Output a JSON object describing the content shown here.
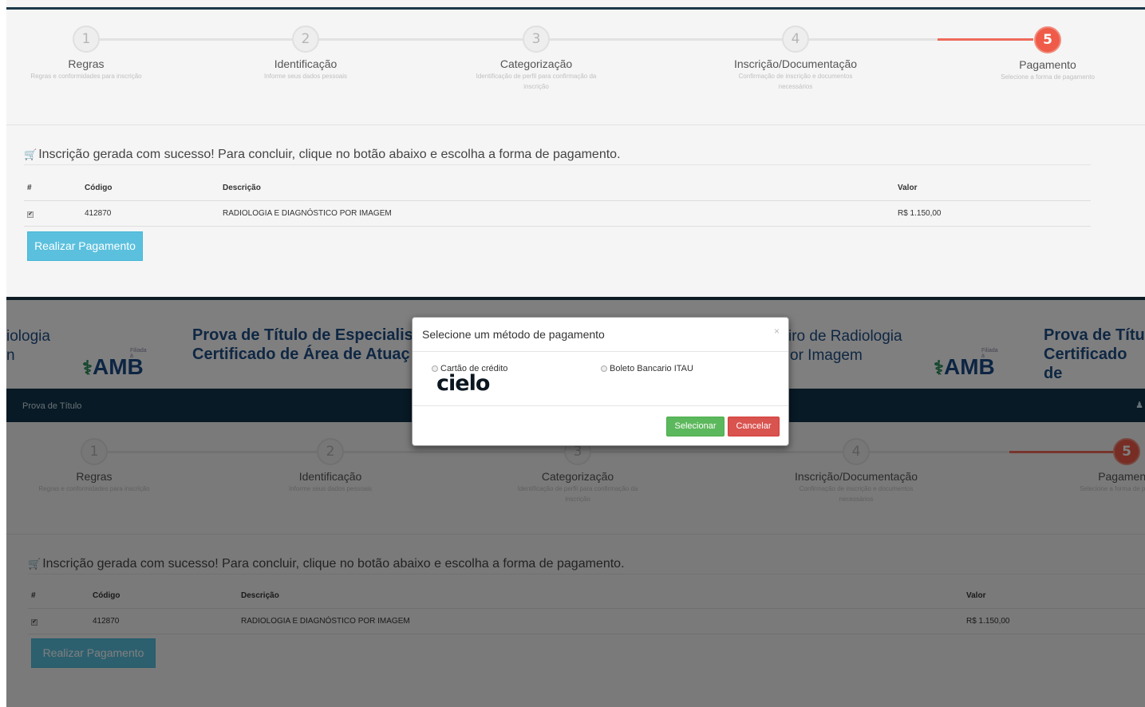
{
  "wizard": {
    "steps": [
      {
        "number": "1",
        "title": "Regras",
        "desc": "Regras e conformidades para inscrição"
      },
      {
        "number": "2",
        "title": "Identificação",
        "desc": "Informe seus dados pessoais"
      },
      {
        "number": "3",
        "title": "Categorização",
        "desc": "Identificação de perfil para confirmação da inscrição"
      },
      {
        "number": "4",
        "title": "Inscrição/Documentação",
        "desc": "Confirmação de inscrição e documentos necessários"
      },
      {
        "number": "5",
        "title": "Pagamento",
        "desc": "Selecione a forma de pagamento"
      }
    ],
    "active_step": 5,
    "active_color": "#ef5b48"
  },
  "success_message": "Inscrição gerada com sucesso! Para concluir, clique no botão abaixo e escolha a forma de pagamento.",
  "table": {
    "headers": [
      "#",
      "Código",
      "Descrição",
      "Valor"
    ],
    "rows": [
      {
        "checked": "✔",
        "codigo": "412870",
        "descricao": "RADIOLOGIA E DIAGNÓSTICO POR IMAGEM",
        "valor": "R$ 1.150,00"
      }
    ]
  },
  "pay_button": "Realizar Pagamento",
  "banner": {
    "left_fragment_1": "iologia",
    "left_fragment_2": "n",
    "title_line1": "Prova de Título de Especialis",
    "title_line2": "Certificado de Área de Atuaç",
    "mid_line1": "iro de Radiologia",
    "mid_line2": "or Imagem",
    "right_line1": "Prova de Títu",
    "right_line2": "Certificado de",
    "amb": "AMB",
    "amb_small": "Filiada à",
    "amb_symbol": "⚕"
  },
  "navbar": {
    "brand": "Prova de Título",
    "user_icon": "user-icon",
    "user_glyph": "♟"
  },
  "modal": {
    "title": "Selecione um método de pagamento",
    "close": "×",
    "option_credit": "Cartão de crédito",
    "option_boleto": "Boleto Bancario ITAU",
    "cielo_text": "cielo",
    "select_button": "Selecionar",
    "cancel_button": "Cancelar"
  },
  "icons": {
    "cart": "🛒"
  },
  "colors": {
    "accent": "#5bc0de",
    "navbar": "#10344a",
    "banner_text": "#1f4e86",
    "step_active": "#ef5b48"
  }
}
